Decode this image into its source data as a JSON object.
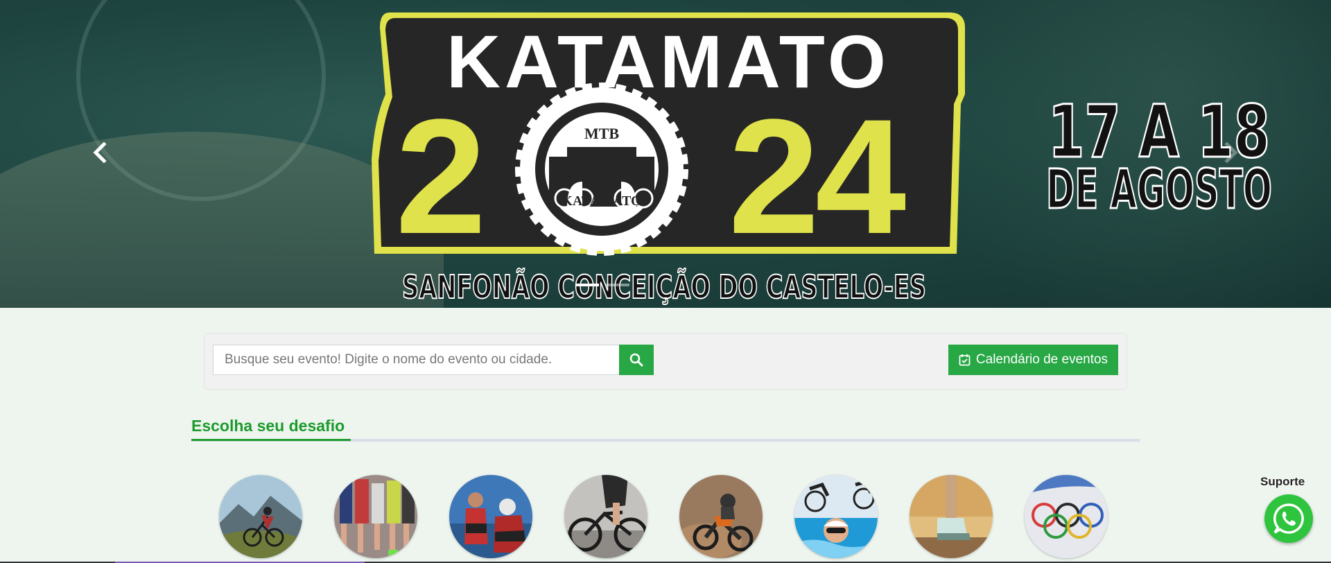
{
  "banner": {
    "event_name": "KATAMATO",
    "year_left": "2",
    "year_right": "24",
    "badge_top": "MTB",
    "badge_bottom": "KATAMATO",
    "date_line1": "17 A 18",
    "date_line2": "DE AGOSTO",
    "location": "SANFONÃO CONCEIÇÃO DO CASTELO-ES",
    "slide_count": 2,
    "active_slide": 0,
    "colors": {
      "accent": "#dfe24a",
      "logo_dark": "#262626",
      "background": "#1f4540"
    },
    "icons": {
      "prev": "chevron-left-icon",
      "next": "chevron-right-icon"
    }
  },
  "search": {
    "placeholder": "Busque seu evento! Digite o nome do evento ou cidade.",
    "value": "",
    "button_icon": "search-icon"
  },
  "calendar_button": {
    "label": "Calendário de eventos",
    "icon": "calendar-check-icon"
  },
  "section": {
    "title": "Escolha seu desafio"
  },
  "categories": [
    {
      "name": "mountain-bike",
      "icon": "mountain-bike-photo"
    },
    {
      "name": "corrida-de-rua",
      "icon": "street-running-photo"
    },
    {
      "name": "triathlon",
      "icon": "triathlon-photo"
    },
    {
      "name": "ciclismo",
      "icon": "road-cycling-photo"
    },
    {
      "name": "motocross",
      "icon": "motocross-photo"
    },
    {
      "name": "multiesportes",
      "icon": "multisport-photo"
    },
    {
      "name": "caminhada",
      "icon": "walking-photo"
    },
    {
      "name": "olimpiadas",
      "icon": "olympic-rings-photo"
    }
  ],
  "support": {
    "label": "Suporte",
    "icon": "whatsapp-icon"
  },
  "colors": {
    "primary_green": "#28a745",
    "heading_green": "#1c9b2d",
    "page_background": "#eef5ef"
  }
}
